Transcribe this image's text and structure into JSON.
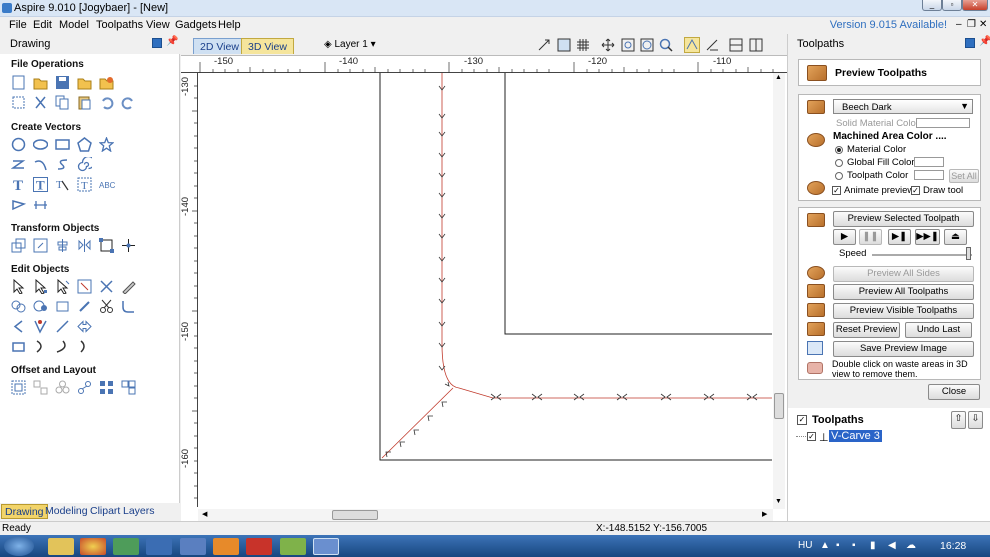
{
  "window": {
    "title": "Aspire 9.010 [Jogybaer] - [New]",
    "version_notice": "Version 9.015 Available!"
  },
  "menu": [
    "File",
    "Edit",
    "Model",
    "Toolpaths",
    "View",
    "Gadgets",
    "Help"
  ],
  "left_panel": {
    "title": "Drawing",
    "sections": {
      "file_ops": "File Operations",
      "create_vectors": "Create Vectors",
      "transform": "Transform Objects",
      "edit": "Edit Objects",
      "offset": "Offset and Layout"
    },
    "bottom_tabs": [
      "Drawing",
      "Modeling",
      "Clipart",
      "Layers"
    ]
  },
  "view_tabs": {
    "tab_2d": "2D View",
    "tab_3d": "3D View",
    "layer": "Layer 1"
  },
  "rulers": {
    "h": [
      "-150",
      "-140",
      "-130",
      "-120",
      "-110"
    ],
    "v": [
      "-130",
      "-140",
      "-150",
      "-160"
    ]
  },
  "right_panel": {
    "title": "Toolpaths",
    "preview_title": "Preview Toolpaths",
    "material": "Beech Dark",
    "solid_material_color": "Solid Material Color",
    "machined_area_color": "Machined Area Color ....",
    "radio": [
      "Material Color",
      "Global Fill Color",
      "Toolpath Color"
    ],
    "set_all": "Set All",
    "animate_preview": "Animate preview",
    "draw_tool": "Draw tool",
    "preview_selected": "Preview Selected Toolpath",
    "speed": "Speed",
    "preview_all_sides": "Preview All Sides",
    "preview_all_toolpaths": "Preview All Toolpaths",
    "preview_visible": "Preview Visible Toolpaths",
    "reset_preview": "Reset Preview",
    "undo_last": "Undo Last",
    "save_preview_image": "Save Preview Image",
    "hint": "Double click on waste areas in 3D view to remove them.",
    "close": "Close",
    "toolpaths_header": "Toolpaths",
    "toolpath_item": "V-Carve 3"
  },
  "status": {
    "left": "Ready",
    "coords": "X:-148.5152 Y:-156.7005"
  },
  "taskbar": {
    "lang": "HU",
    "time": "16:28"
  },
  "colors": {
    "accent": "#2f6fbf",
    "toolpath": "#c0392b",
    "selection": "#2a64c8"
  },
  "icons": [
    "new-file-icon",
    "open-folder-icon",
    "save-icon",
    "import-icon",
    "line-icon",
    "circle-icon",
    "rectangle-icon",
    "star-icon",
    "text-icon"
  ]
}
